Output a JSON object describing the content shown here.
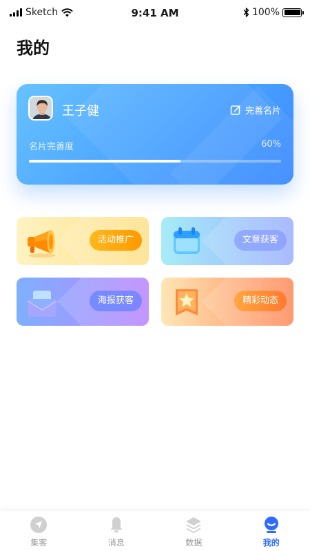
{
  "status_bar": {
    "carrier": "Sketch",
    "time": "9:41 AM",
    "battery": "100%"
  },
  "page_title": "我的",
  "profile": {
    "name": "王子健",
    "edit_label": "完善名片",
    "progress_label": "名片完善度",
    "progress_value": "60%",
    "progress_fraction": 0.6
  },
  "features": [
    {
      "label": "活动推广",
      "icon": "megaphone-icon"
    },
    {
      "label": "文章获客",
      "icon": "calendar-icon"
    },
    {
      "label": "海报获客",
      "icon": "envelope-icon"
    },
    {
      "label": "精彩动态",
      "icon": "star-badge-icon"
    }
  ],
  "tabs": [
    {
      "label": "集客",
      "icon": "compass-icon",
      "active": false
    },
    {
      "label": "消息",
      "icon": "bell-icon",
      "active": false
    },
    {
      "label": "数据",
      "icon": "layers-icon",
      "active": false
    },
    {
      "label": "我的",
      "icon": "user-icon",
      "active": true
    }
  ],
  "colors": {
    "accent": "#2f6bff",
    "card_gradient_start": "#67c2ff",
    "card_gradient_end": "#3c8bff",
    "tab_inactive": "#999999"
  }
}
